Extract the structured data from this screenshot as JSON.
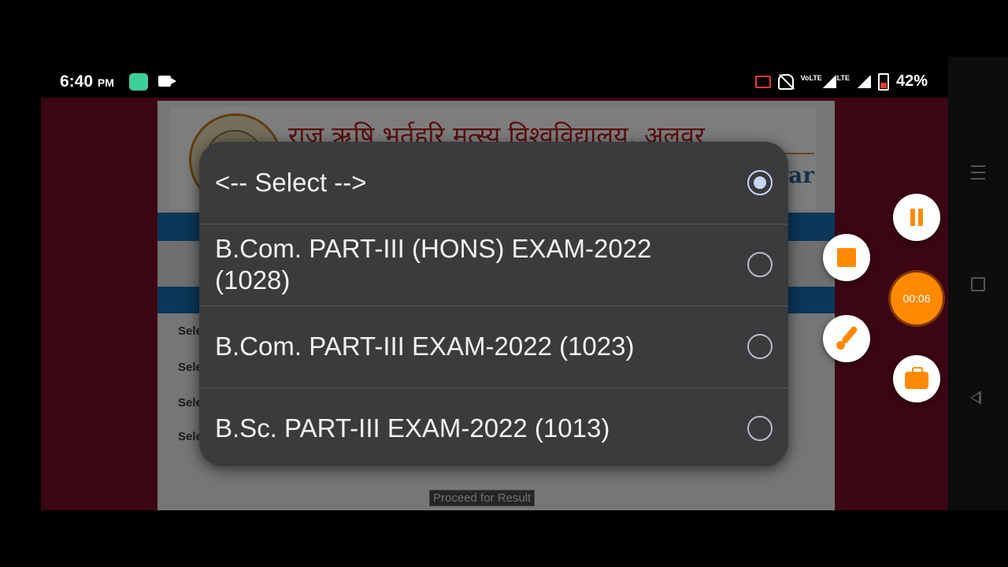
{
  "status_bar": {
    "time": "6:40",
    "ampm": "PM",
    "network": "LTE",
    "volte": "VoLTE",
    "battery_percent": "42%"
  },
  "webpage": {
    "university_name_hindi": "राज ऋषि भर्तृहरि मत्स्य विश्वविद्यालय, अलवर",
    "english_fragment": "var",
    "form_labels": [
      "Sele",
      "Sele",
      "Sele",
      "Sele"
    ],
    "proceed_button": "Proceed for Result"
  },
  "dialog": {
    "options": [
      {
        "label": "<-- Select -->",
        "selected": true
      },
      {
        "label": "B.Com. PART-III (HONS) EXAM-2022 (1028)",
        "selected": false
      },
      {
        "label": "B.Com. PART-III EXAM-2022 (1023)",
        "selected": false
      },
      {
        "label": "B.Sc. PART-III EXAM-2022 (1013)",
        "selected": false
      }
    ]
  },
  "recorder": {
    "timer": "00:06",
    "accent_color": "#ff8a00"
  }
}
